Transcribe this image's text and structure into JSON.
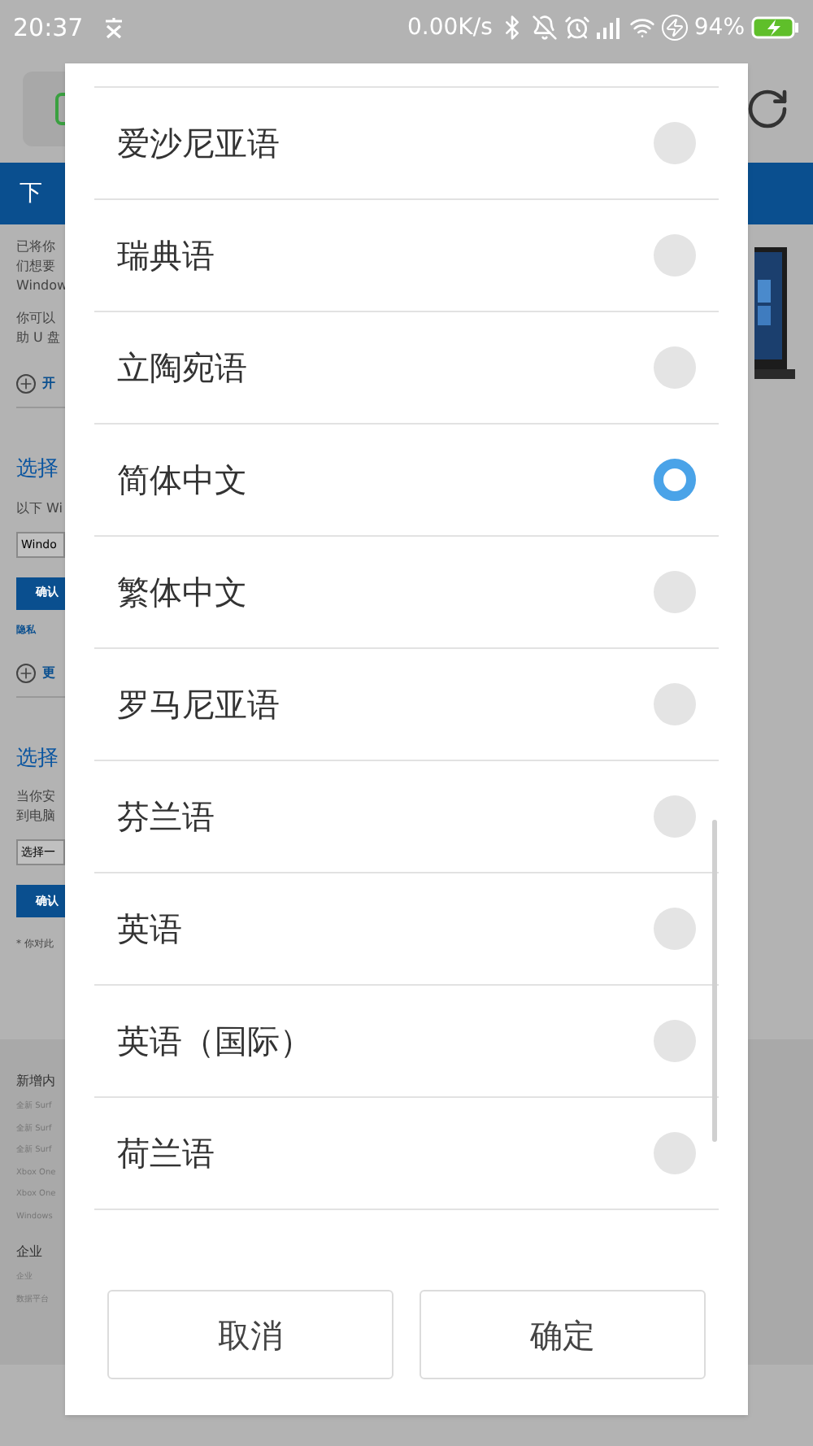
{
  "status_bar": {
    "time": "20:37",
    "network_speed": "0.00K/s",
    "battery": "94%"
  },
  "page": {
    "banner": "下",
    "blocks": [
      {
        "kind": "text",
        "lines": [
          "已将你",
          "们想要",
          "Window"
        ]
      },
      {
        "kind": "text",
        "lines": [
          "你可以",
          "助 U 盘"
        ]
      },
      {
        "kind": "expander",
        "label": "开"
      },
      {
        "kind": "heading",
        "label": "选择"
      },
      {
        "kind": "text",
        "lines": [
          "以下 Wi"
        ]
      },
      {
        "kind": "select",
        "label": "Windo"
      },
      {
        "kind": "button",
        "label": "确认"
      },
      {
        "kind": "link",
        "label": "隐私"
      },
      {
        "kind": "expander",
        "label": "更"
      },
      {
        "kind": "heading",
        "label": "选择"
      },
      {
        "kind": "text",
        "lines": [
          "当你安",
          "到电脑"
        ]
      },
      {
        "kind": "select",
        "label": "选择一"
      },
      {
        "kind": "button",
        "label": "确认"
      },
      {
        "kind": "note",
        "label": "* 你对此"
      }
    ],
    "footer": [
      {
        "kind": "footer-heading",
        "label": "新增内"
      },
      {
        "kind": "footer-link",
        "label": "全新 Surf"
      },
      {
        "kind": "footer-link",
        "label": "全新 Surf"
      },
      {
        "kind": "footer-link",
        "label": "全新 Surf"
      },
      {
        "kind": "footer-link",
        "label": "Xbox One"
      },
      {
        "kind": "footer-link",
        "label": "Xbox One"
      },
      {
        "kind": "footer-link",
        "label": "Windows"
      },
      {
        "kind": "footer-heading",
        "label": "企业"
      },
      {
        "kind": "footer-link",
        "label": "企业"
      },
      {
        "kind": "footer-link",
        "label": "数据平台"
      }
    ]
  },
  "dialog": {
    "options": [
      {
        "label": "爱沙尼亚语",
        "selected": false
      },
      {
        "label": "瑞典语",
        "selected": false
      },
      {
        "label": "立陶宛语",
        "selected": false
      },
      {
        "label": "简体中文",
        "selected": true
      },
      {
        "label": "繁体中文",
        "selected": false
      },
      {
        "label": "罗马尼亚语",
        "selected": false
      },
      {
        "label": "芬兰语",
        "selected": false
      },
      {
        "label": "英语",
        "selected": false
      },
      {
        "label": "英语（国际）",
        "selected": false
      },
      {
        "label": "荷兰语",
        "selected": false
      }
    ],
    "buttons": [
      {
        "label": "取消"
      },
      {
        "label": "确定"
      }
    ]
  }
}
